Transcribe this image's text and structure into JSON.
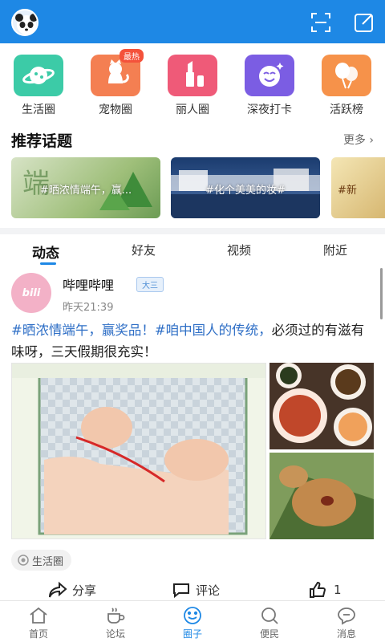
{
  "header": {
    "avatar_icon": "panda-avatar-icon",
    "scan_icon": "scan-icon",
    "compose_icon": "compose-icon",
    "bg": "#1e88e5"
  },
  "quick": [
    {
      "label": "生活圈",
      "icon": "planet-icon",
      "color": "#3ccba7"
    },
    {
      "label": "宠物圈",
      "icon": "cat-icon",
      "color": "#f47f52",
      "badge": "最热"
    },
    {
      "label": "丽人圈",
      "icon": "lipstick-icon",
      "color": "#ef5a78"
    },
    {
      "label": "深夜打卡",
      "icon": "smile-icon",
      "color": "#7b5de3"
    },
    {
      "label": "活跃榜",
      "icon": "balloon-icon",
      "color": "#f6924a"
    }
  ],
  "topics_section": {
    "title": "推荐话题",
    "more": "更多"
  },
  "topics": [
    {
      "text": "#晒浓情端午，赢..."
    },
    {
      "text": "#化个美美的妆#"
    },
    {
      "text": "#新"
    }
  ],
  "tabs": [
    "动态",
    "好友",
    "视频",
    "附近"
  ],
  "post": {
    "author": "哔哩哔哩",
    "level": "大三",
    "time": "昨天21:39",
    "tag1": "#晒浓情端午，赢奖品！",
    "tag2": "#咱中国人的传统，",
    "body": "必须过的有滋有味呀，三天假期很充实！",
    "circle": "生活圈",
    "share": "分享",
    "comment": "评论",
    "likes": "1"
  },
  "nav": [
    {
      "label": "首页",
      "icon": "home-icon"
    },
    {
      "label": "论坛",
      "icon": "coffee-icon"
    },
    {
      "label": "圈子",
      "icon": "circle-icon",
      "active": true
    },
    {
      "label": "便民",
      "icon": "search-icon"
    },
    {
      "label": "消息",
      "icon": "message-icon"
    }
  ]
}
